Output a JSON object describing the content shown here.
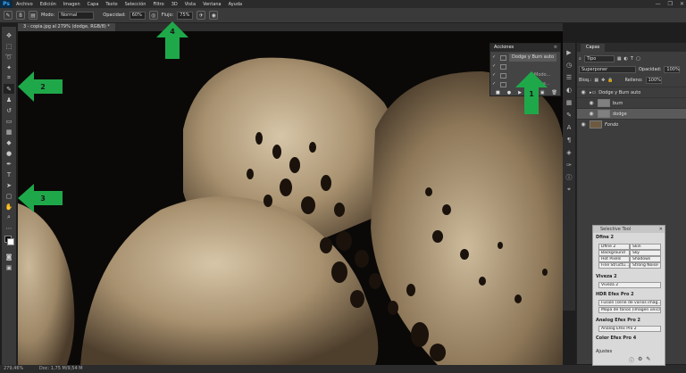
{
  "app": {
    "logo": "Ps"
  },
  "menu": [
    "Archivo",
    "Edición",
    "Imagen",
    "Capa",
    "Texto",
    "Selección",
    "Filtro",
    "3D",
    "Vista",
    "Ventana",
    "Ayuda"
  ],
  "window_controls": [
    "—",
    "❐",
    "✕"
  ],
  "options": {
    "brush_size": "8",
    "mode_label": "Modo:",
    "mode_value": "Normal",
    "opacity_label": "Opacidad:",
    "opacity_value": "60%",
    "flow_label": "Flujo:",
    "flow_value": "75%"
  },
  "document": {
    "tab_label": "3 - copia.jpg al 279% (dodge, RGB/8) *"
  },
  "status": {
    "zoom": "279,46%",
    "doc": "Doc: 1,75 M/9,54 M"
  },
  "acciones": {
    "title": "Acciones",
    "rows": [
      "Dodge y Burn auto",
      "",
      "",
      "",
      ""
    ],
    "extra_labels": [
      "Auto...",
      "Modo...",
      "Capa..."
    ]
  },
  "layers": {
    "tab": "Capas",
    "filter_label": "Tipo",
    "blend_mode": "Superponer",
    "opacity_label": "Opacidad:",
    "opacity_value": "100%",
    "lock_label": "Bloq.:",
    "fill_label": "Relleno:",
    "fill_value": "100%",
    "items": [
      {
        "name": "Dodge y Burn auto",
        "type": "group"
      },
      {
        "name": "burn",
        "type": "layer"
      },
      {
        "name": "dodge",
        "type": "layer",
        "selected": true
      },
      {
        "name": "Fondo",
        "type": "background"
      }
    ]
  },
  "selective_tool": {
    "title": "Selective Tool",
    "sections": [
      {
        "name": "Dfine 2",
        "items": [
          "Dfine 2",
          "Skin",
          "Background",
          "Sky",
          "Hot Pixels",
          "Shadows",
          "Fine Structu...",
          "Strong Noise"
        ]
      },
      {
        "name": "Viveza 2",
        "items": [
          "Viveza 2"
        ]
      },
      {
        "name": "HDR Efex Pro 2",
        "items": [
          "Fusión (serie de varios imág...",
          "Mapa de tonos (imagen única)"
        ]
      },
      {
        "name": "Analog Efex Pro 2",
        "items": [
          "Analog Efex Pro 2"
        ]
      },
      {
        "name": "Color Efex Pro 4",
        "items": []
      }
    ],
    "footer": "Ajustes"
  },
  "annotations": [
    "1",
    "2",
    "3",
    "4"
  ],
  "colors": {
    "arrow": "#1fa84a",
    "canvas_bg": "#0b0907",
    "sepia_light": "#c8b79a",
    "sepia_dark": "#5a4a36"
  }
}
